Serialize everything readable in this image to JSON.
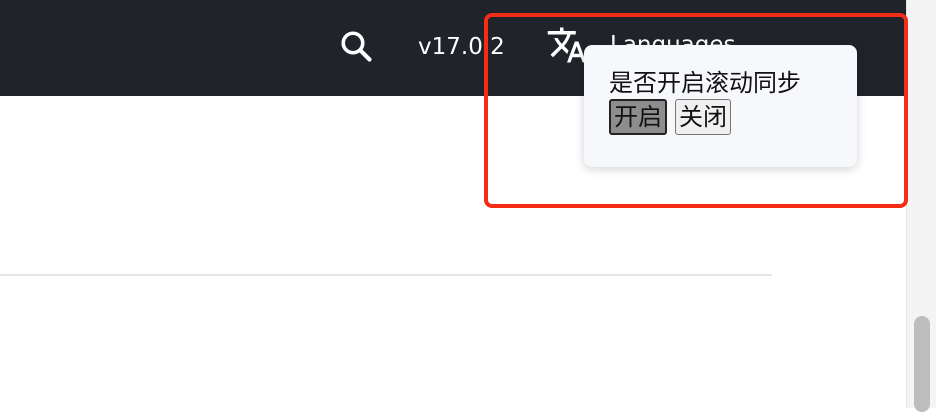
{
  "header": {
    "version": "v17.0.2",
    "languages_label": "Languages",
    "search_icon": "search-icon",
    "language_icon": "translate-icon"
  },
  "popup": {
    "title": "是否开启滚动同步",
    "enable_label": "开启",
    "disable_label": "关闭",
    "selected": "开启"
  },
  "colors": {
    "header_bg": "#20232a",
    "highlight_border": "#f52d16",
    "popup_bg": "#f7f8fc"
  }
}
